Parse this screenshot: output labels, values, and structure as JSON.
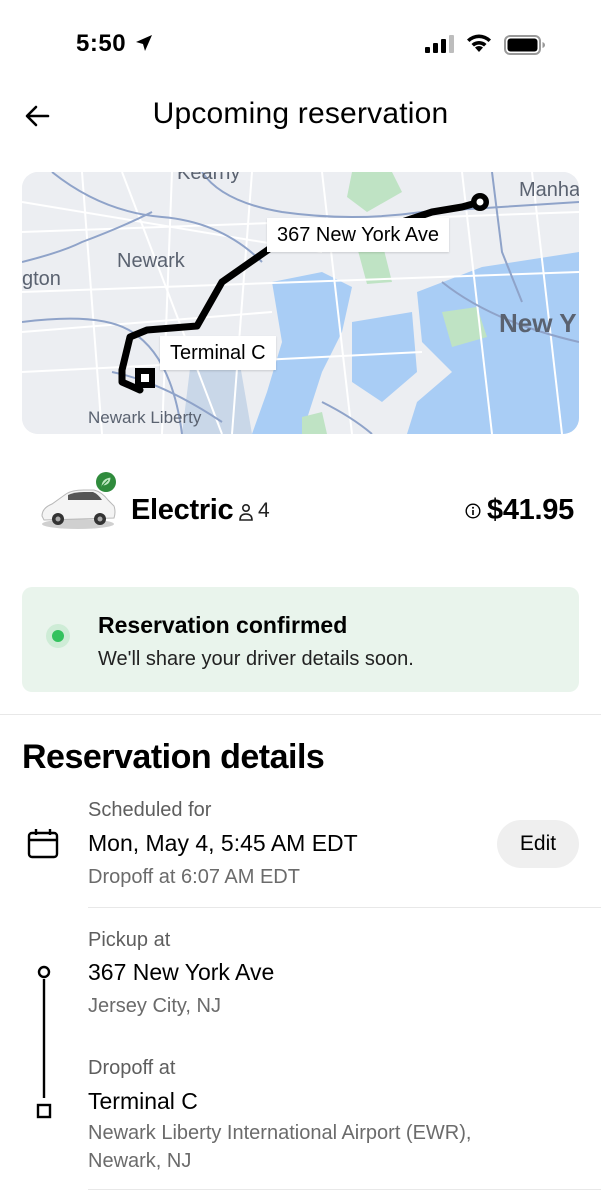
{
  "status_bar": {
    "time": "5:50",
    "icons": [
      "location-arrow-icon",
      "cellular-signal-icon",
      "wifi-icon",
      "battery-icon"
    ]
  },
  "header": {
    "back_icon": "back-arrow-icon",
    "title": "Upcoming reservation"
  },
  "map": {
    "pickup_label": "367 New York Ave",
    "dropoff_label": "Terminal C",
    "places": [
      "Kearny",
      "Newark",
      "gton",
      "Manha",
      "New Y",
      "Newark Liberty"
    ]
  },
  "ride": {
    "name": "Electric",
    "seats": "4",
    "price": "$41.95",
    "icons": [
      "car-icon",
      "leaf-icon",
      "person-icon",
      "info-icon"
    ]
  },
  "confirmation": {
    "title": "Reservation confirmed",
    "subtitle": "We'll share your driver details soon."
  },
  "details": {
    "title": "Reservation details",
    "schedule": {
      "label": "Scheduled for",
      "value": "Mon, May 4, 5:45 AM EDT",
      "sub": "Dropoff at 6:07 AM EDT",
      "edit_label": "Edit"
    },
    "pickup": {
      "label": "Pickup at",
      "value": "367 New York Ave",
      "sub": "Jersey City, NJ"
    },
    "dropoff": {
      "label": "Dropoff at",
      "value": "Terminal C",
      "sub_line1": "Newark Liberty International Airport (EWR),",
      "sub_line2": "Newark, NJ"
    }
  },
  "colors": {
    "confirm_bg": "#e9f4ec",
    "confirm_dot": "#34c25e",
    "water": "#a9cdf5",
    "park": "#bfe3c4",
    "route": "#000000"
  }
}
